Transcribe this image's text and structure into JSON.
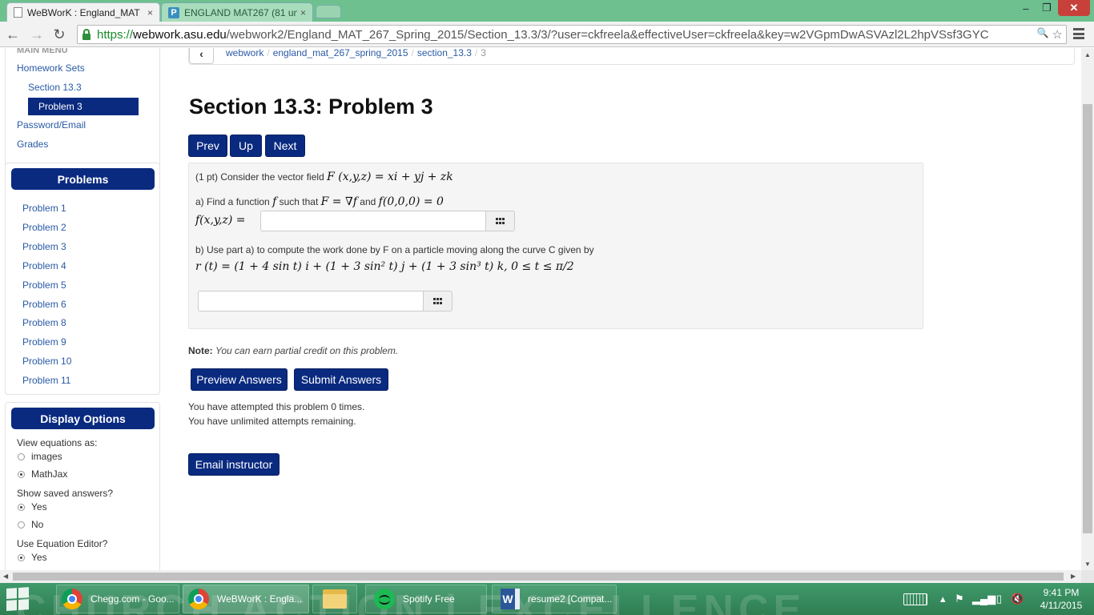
{
  "browser": {
    "tabs": [
      {
        "title": "WeBWorK : England_MAT",
        "close": "×"
      },
      {
        "title": "ENGLAND MAT267 (81 un",
        "close": "×",
        "favicon": "P"
      }
    ],
    "window_controls": {
      "minimize": "–",
      "maximize": "❐",
      "close": "✕"
    },
    "nav": {
      "back": "←",
      "forward": "→",
      "reload": "↻"
    },
    "url": {
      "scheme": "https://",
      "host": "webwork.asu.edu",
      "path": "/webwork2/England_MAT_267_Spring_2015/Section_13.3/3/?user=ckfreela&effectiveUser=ckfreela&key=w2VGpmDwASVAzl2L2hpVSsf3GYC"
    },
    "omni_icons": {
      "search": "🔍",
      "star": "☆"
    }
  },
  "sidebar": {
    "main_menu_label": "MAIN MENU",
    "homework_sets": "Homework Sets",
    "section": "Section 13.3",
    "active_problem": "Problem 3",
    "password_email": "Password/Email",
    "grades": "Grades",
    "problems_header": "Problems",
    "problems": [
      "Problem 1",
      "Problem 2",
      "Problem 3",
      "Problem 4",
      "Problem 5",
      "Problem 6",
      "Problem 8",
      "Problem 9",
      "Problem 10",
      "Problem 11"
    ],
    "display_options_header": "Display Options",
    "view_equations_label": "View equations as:",
    "view_options": [
      {
        "label": "images",
        "checked": false
      },
      {
        "label": "MathJax",
        "checked": true
      }
    ],
    "show_saved_label": "Show saved answers?",
    "show_saved_options": [
      {
        "label": "Yes",
        "checked": true
      },
      {
        "label": "No",
        "checked": false
      }
    ],
    "use_editor_label": "Use Equation Editor?",
    "use_editor_options": [
      {
        "label": "Yes",
        "checked": true
      }
    ]
  },
  "breadcrumb": {
    "back": "‹",
    "items": [
      "webwork",
      "england_mat_267_spring_2015",
      "section_13.3"
    ],
    "current": "3",
    "separator": "/"
  },
  "main": {
    "title": "Section 13.3: Problem 3",
    "nav_buttons": {
      "prev": "Prev",
      "up": "Up",
      "next": "Next"
    },
    "problem": {
      "intro": "(1 pt) Consider the vector field",
      "field_math": "F (x,y,z) = xi + yj + zk",
      "part_a_text": "a) Find a function",
      "part_a_f": "f",
      "part_a_such": "such that",
      "part_a_cond": "F = ∇f",
      "part_a_and": "and",
      "part_a_init": "f(0,0,0) = 0",
      "answer_a_label": "f(x,y,z) =",
      "answer_a_value": "",
      "part_b_text": "b) Use part a) to compute the work done by F on a particle moving along the curve C given by",
      "curve_math": "r (t) = (1 + 4 sin t) i + (1 + 3 sin² t) j + (1 + 3 sin³ t) k,   0 ≤ t ≤ π/2",
      "answer_b_value": ""
    },
    "note_label": "Note:",
    "note_text": "You can earn partial credit on this problem.",
    "preview_button": "Preview Answers",
    "submit_button": "Submit Answers",
    "attempts_text": "You have attempted this problem 0 times.",
    "remaining_text": "You have unlimited attempts remaining.",
    "email_button": "Email instructor"
  },
  "taskbar": {
    "items": [
      {
        "label": "Chegg.com - Goo..."
      },
      {
        "label": "WeBWorK : Engla..."
      },
      {
        "label": ""
      },
      {
        "label": "Spotify Free"
      },
      {
        "label": "resume2 [Compat..."
      }
    ],
    "clock_time": "9:41 PM",
    "clock_date": "4/11/2015",
    "background_text": "CHURCH  ACTION  |  EXCELLENCE"
  }
}
